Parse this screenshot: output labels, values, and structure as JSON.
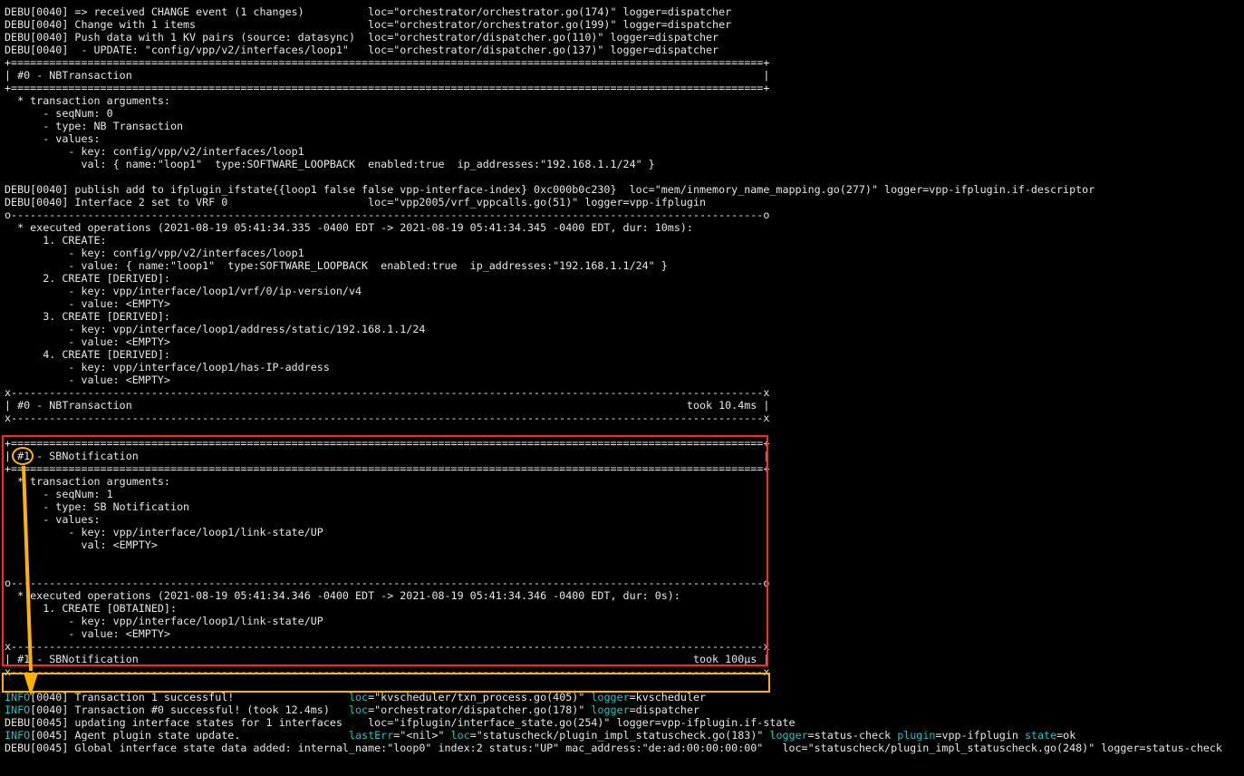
{
  "terminal": {
    "lines": [
      "DEBU[0040] => received CHANGE event (1 changes)          loc=\"orchestrator/orchestrator.go(174)\" logger=dispatcher",
      "DEBU[0040] Change with 1 items                           loc=\"orchestrator/orchestrator.go(199)\" logger=dispatcher",
      "DEBU[0040] Push data with 1 KV pairs (source: datasync)  loc=\"orchestrator/dispatcher.go(110)\" logger=dispatcher",
      "DEBU[0040]  - UPDATE: \"config/vpp/v2/interfaces/loop1\"   loc=\"orchestrator/dispatcher.go(137)\" logger=dispatcher",
      "+======================================================================================================================+",
      "| #0 - NBTransaction                                                                                                   |",
      "+======================================================================================================================+",
      "  * transaction arguments:",
      "      - seqNum: 0",
      "      - type: NB Transaction",
      "      - values:",
      "          - key: config/vpp/v2/interfaces/loop1",
      "            val: { name:\"loop1\"  type:SOFTWARE_LOOPBACK  enabled:true  ip_addresses:\"192.168.1.1/24\" }",
      "",
      "DEBU[0040] publish add to ifplugin_ifstate{{loop1 false false vpp-interface-index} 0xc000b0c230}  loc=\"mem/inmemory_name_mapping.go(277)\" logger=vpp-ifplugin.if-descriptor",
      "DEBU[0040] Interface 2 set to VRF 0                      loc=\"vpp2005/vrf_vppcalls.go(51)\" logger=vpp-ifplugin",
      "o----------------------------------------------------------------------------------------------------------------------o",
      "  * executed operations (2021-08-19 05:41:34.335 -0400 EDT -> 2021-08-19 05:41:34.345 -0400 EDT, dur: 10ms):",
      "      1. CREATE:",
      "          - key: config/vpp/v2/interfaces/loop1",
      "          - value: { name:\"loop1\"  type:SOFTWARE_LOOPBACK  enabled:true  ip_addresses:\"192.168.1.1/24\" }",
      "      2. CREATE [DERIVED]:",
      "          - key: vpp/interface/loop1/vrf/0/ip-version/v4",
      "          - value: <EMPTY>",
      "      3. CREATE [DERIVED]:",
      "          - key: vpp/interface/loop1/address/static/192.168.1.1/24",
      "          - value: <EMPTY>",
      "      4. CREATE [DERIVED]:",
      "          - key: vpp/interface/loop1/has-IP-address",
      "          - value: <EMPTY>",
      "x----------------------------------------------------------------------------------------------------------------------x",
      "| #0 - NBTransaction                                                                                       took 10.4ms |",
      "x----------------------------------------------------------------------------------------------------------------------x",
      "",
      "+======================================================================================================================+",
      "| #1 - SBNotification                                                                                                  |",
      "+======================================================================================================================+",
      "  * transaction arguments:",
      "      - seqNum: 1",
      "      - type: SB Notification",
      "      - values:",
      "          - key: vpp/interface/loop1/link-state/UP",
      "            val: <EMPTY>",
      "",
      "",
      "o----------------------------------------------------------------------------------------------------------------------o",
      "  * executed operations (2021-08-19 05:41:34.346 -0400 EDT -> 2021-08-19 05:41:34.346 -0400 EDT, dur: 0s):",
      "      1. CREATE [OBTAINED]:",
      "          - key: vpp/interface/loop1/link-state/UP",
      "          - value: <EMPTY>",
      "x----------------------------------------------------------------------------------------------------------------------x",
      "| #1 - SBNotification                                                                                       took 100µs |",
      "x----------------------------------------------------------------------------------------------------------------------x",
      ""
    ],
    "colored_lines": [
      {
        "level": "INFO",
        "rest": "[0040] Transaction 1 successful!                  ",
        "parts": [
          {
            "k": "loc",
            "v": "=\"kvscheduler/txn_process.go(405)\" "
          },
          {
            "k": "logger",
            "v": "=kvscheduler"
          }
        ]
      },
      {
        "level": "INFO",
        "rest": "[0040] Transaction #0 successful! (took 12.4ms)   ",
        "parts": [
          {
            "k": "loc",
            "v": "=\"orchestrator/dispatcher.go(178)\" "
          },
          {
            "k": "logger",
            "v": "=dispatcher"
          }
        ]
      }
    ],
    "debu_line_1": "DEBU[0045] updating interface states for 1 interfaces    loc=\"ifplugin/interface_state.go(254)\" logger=vpp-ifplugin.if-state",
    "info_line_3": {
      "level": "INFO",
      "rest": "[0045] Agent plugin state update.                 ",
      "parts": [
        {
          "k": "lastErr",
          "v": "=\"<nil>\" "
        },
        {
          "k": "loc",
          "v": "=\"statuscheck/plugin_impl_statuscheck.go(183)\" "
        },
        {
          "k": "logger",
          "v": "=status-check "
        },
        {
          "k": "plugin",
          "v": "=vpp-ifplugin "
        },
        {
          "k": "state",
          "v": "=ok"
        }
      ]
    },
    "debu_line_2": "DEBU[0045] Global interface state data added: internal_name:\"loop0\" index:2 status:\"UP\" mac_address:\"de:ad:00:00:00:00\"   loc=\"statuscheck/plugin_impl_statuscheck.go(248)\" logger=status-check"
  },
  "annotations": {
    "box_color": "#ff2a1a",
    "highlight_color": "#ffb300",
    "info_color": "#19c4c4",
    "arrow": "arrow-down"
  }
}
